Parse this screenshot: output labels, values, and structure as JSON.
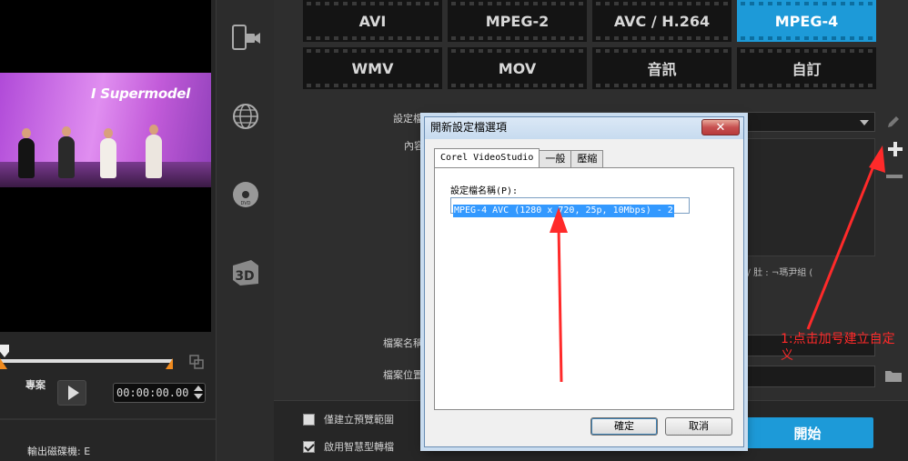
{
  "preview": {
    "banner_text": "I Supermodel",
    "project_label": "專案",
    "timecode": "00:00:00.00",
    "output_drive": "輸出磁碟機: E"
  },
  "formats": {
    "row1": [
      "AVI",
      "MPEG-2",
      "AVC / H.264",
      "MPEG-4"
    ],
    "row2": [
      "WMV",
      "MOV",
      "音訊",
      "自訂"
    ],
    "active": "MPEG-4"
  },
  "settings": {
    "profile_label": "設定檔",
    "content_label": "內容",
    "content_snippet": "1  ∕     肚 : ¬瑪尹組 (",
    "filename_label": "檔案名稱",
    "location_label": "檔案位置"
  },
  "options": {
    "preview_range_only": "僅建立預覽範圍",
    "smart_render": "啟用智慧型轉檔",
    "start_label": "開始"
  },
  "dialog": {
    "title": "開新設定檔選項",
    "close_label": "✕",
    "tabs": [
      "Corel VideoStudio",
      "一般",
      "壓縮"
    ],
    "profile_name_label": "設定檔名稱(P):",
    "profile_name_value": "MPEG-4 AVC (1280 x 720, 25p, 10Mbps) - 2",
    "ok_label": "確定",
    "cancel_label": "取消"
  },
  "annotation": {
    "text": "1:点击加号建立自定义",
    "color": "#ff2a2a"
  },
  "colors": {
    "accent": "#1d9ad8"
  },
  "icons": {
    "rail": [
      "device-camera-icon",
      "globe-icon",
      "disc-icon",
      "3d-icon"
    ],
    "side": [
      "pencil-icon",
      "plus-icon",
      "minus-icon",
      "folder-icon"
    ]
  }
}
